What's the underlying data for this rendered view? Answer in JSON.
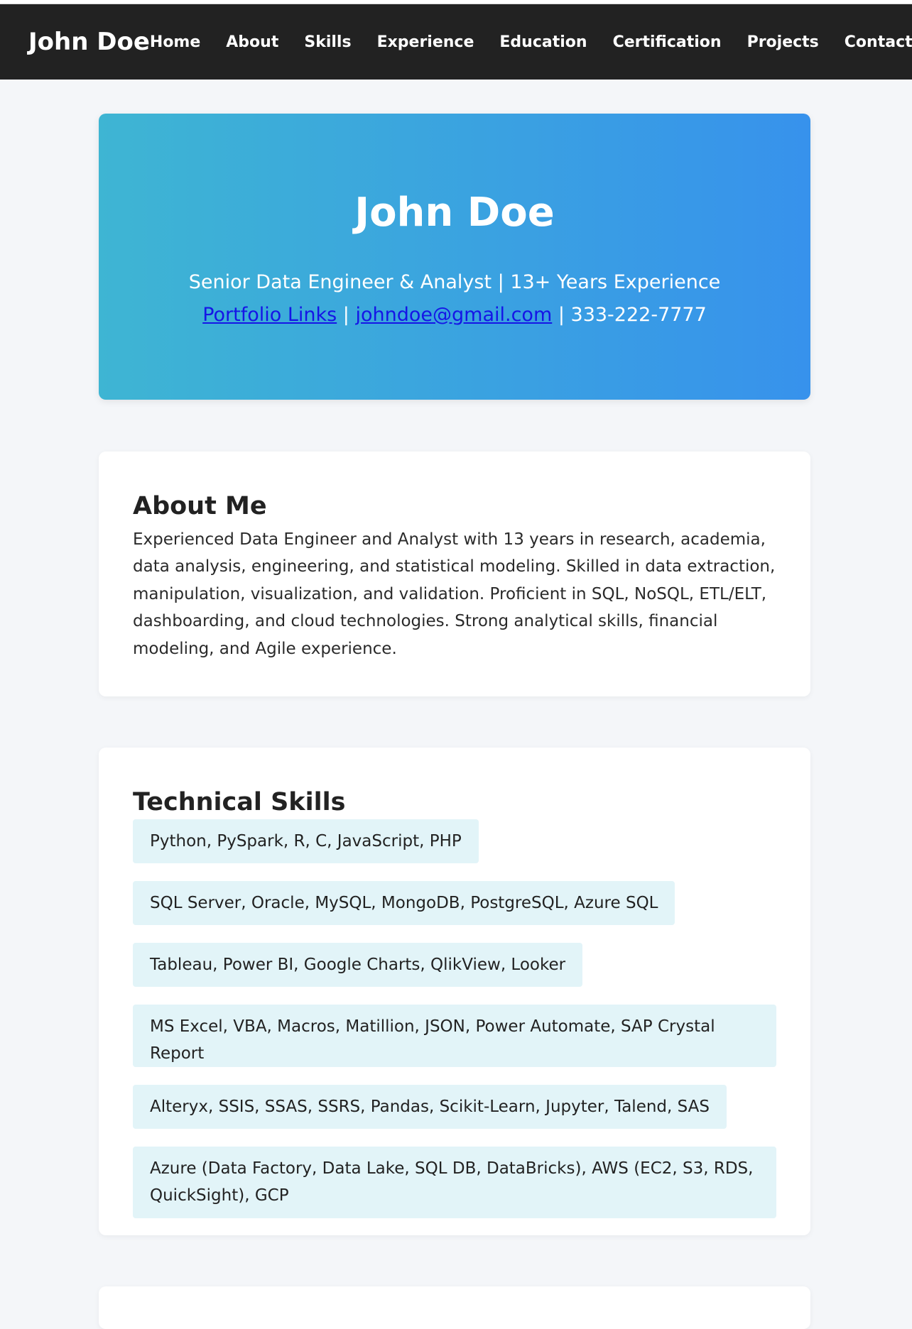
{
  "navbar": {
    "brand": "John Doe",
    "links": [
      "Home",
      "About",
      "Skills",
      "Experience",
      "Education",
      "Certification",
      "Projects",
      "Contact"
    ]
  },
  "hero": {
    "name": "John Doe",
    "tagline": "Senior Data Engineer & Analyst | 13+ Years Experience",
    "portfolio_link": "Portfolio Links",
    "separator": "|",
    "email": "johndoe@gmail.com",
    "phone": "| 333-222-7777"
  },
  "about": {
    "title": "About Me",
    "text": "Experienced Data Engineer and Analyst with 13 years in research, academia, data analysis, engineering, and statistical modeling. Skilled in data extraction, manipulation, visualization, and validation. Proficient in SQL, NoSQL, ETL/ELT, dashboarding, and cloud technologies. Strong analytical skills, financial modeling, and Agile experience."
  },
  "skills": {
    "title": "Technical Skills",
    "items": [
      "Python, PySpark, R, C, JavaScript, PHP",
      "SQL Server, Oracle, MySQL, MongoDB, PostgreSQL, Azure SQL",
      "Tableau, Power BI, Google Charts, QlikView, Looker",
      "MS Excel, VBA, Macros, Matillion, JSON, Power Automate, SAP Crystal Report",
      "Alteryx, SSIS, SSAS, SSRS, Pandas, Scikit-Learn, Jupyter, Talend, SAS",
      "Azure (Data Factory, Data Lake, SQL DB, DataBricks), AWS (EC2, S3, RDS, QuickSight), GCP"
    ]
  }
}
